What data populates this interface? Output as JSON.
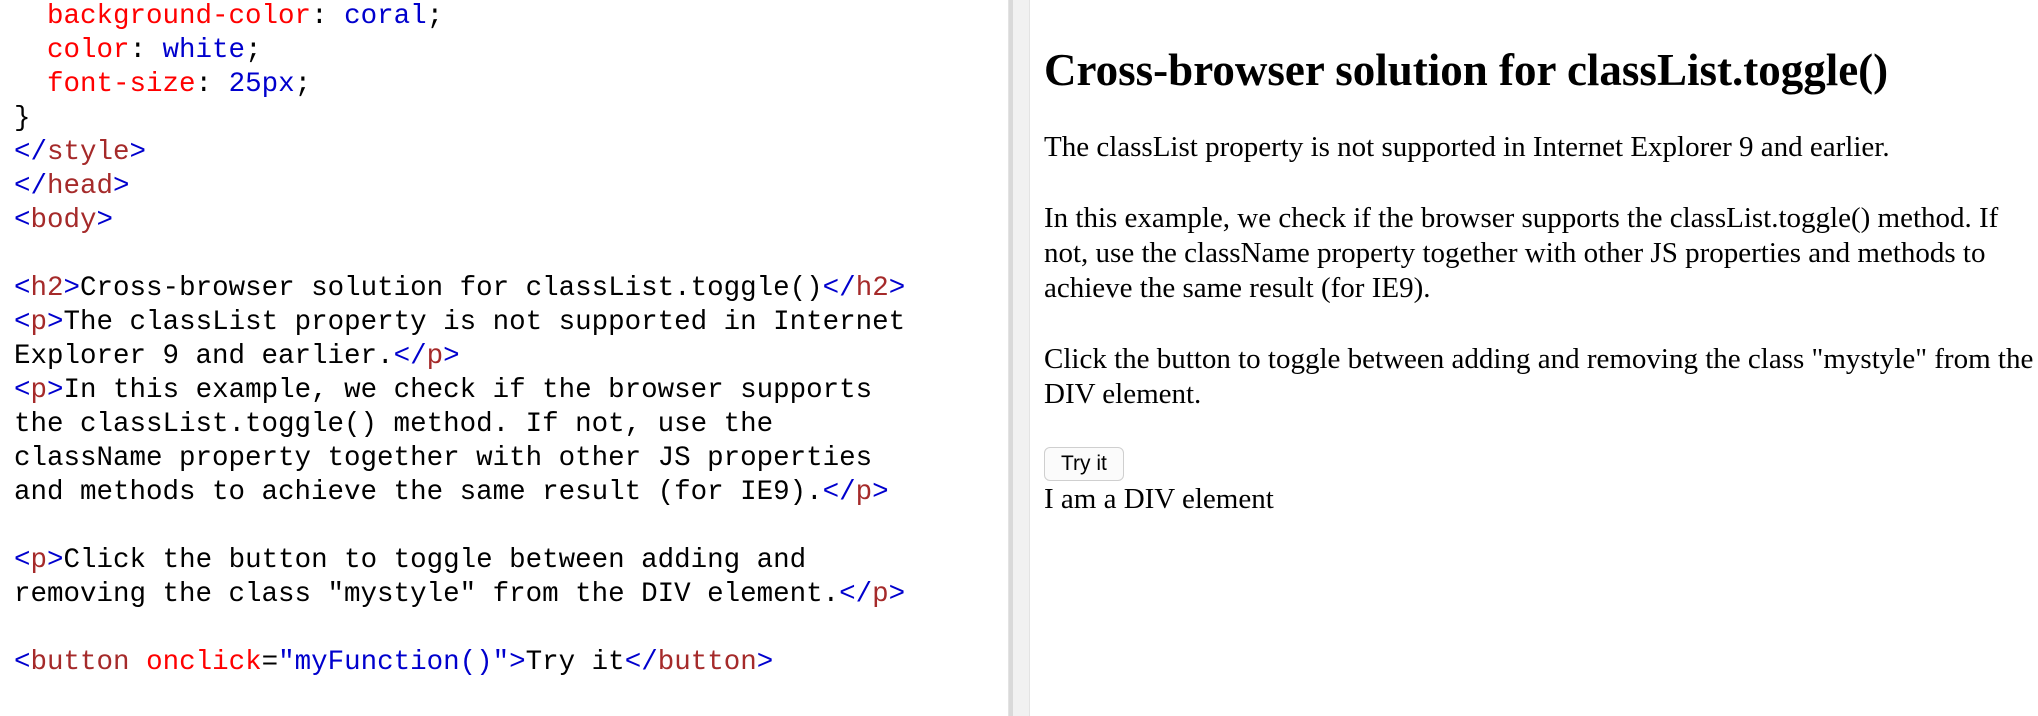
{
  "editor": {
    "lines": [
      [
        {
          "c": "tk-text",
          "t": "  "
        },
        {
          "c": "tk-prop",
          "t": "background-color"
        },
        {
          "c": "tk-text",
          "t": ": "
        },
        {
          "c": "tk-val",
          "t": "coral"
        },
        {
          "c": "tk-text",
          "t": ";"
        }
      ],
      [
        {
          "c": "tk-text",
          "t": "  "
        },
        {
          "c": "tk-prop",
          "t": "color"
        },
        {
          "c": "tk-text",
          "t": ": "
        },
        {
          "c": "tk-val",
          "t": "white"
        },
        {
          "c": "tk-text",
          "t": ";"
        }
      ],
      [
        {
          "c": "tk-text",
          "t": "  "
        },
        {
          "c": "tk-prop",
          "t": "font-size"
        },
        {
          "c": "tk-text",
          "t": ": "
        },
        {
          "c": "tk-val",
          "t": "25px"
        },
        {
          "c": "tk-text",
          "t": ";"
        }
      ],
      [
        {
          "c": "tk-text",
          "t": "}"
        }
      ],
      [
        {
          "c": "tk-tag",
          "t": "</"
        },
        {
          "c": "tk-name",
          "t": "style"
        },
        {
          "c": "tk-tag",
          "t": ">"
        }
      ],
      [
        {
          "c": "tk-tag",
          "t": "</"
        },
        {
          "c": "tk-name",
          "t": "head"
        },
        {
          "c": "tk-tag",
          "t": ">"
        }
      ],
      [
        {
          "c": "tk-tag",
          "t": "<"
        },
        {
          "c": "tk-name",
          "t": "body"
        },
        {
          "c": "tk-tag",
          "t": ">"
        }
      ],
      [],
      [
        {
          "c": "tk-tag",
          "t": "<"
        },
        {
          "c": "tk-name",
          "t": "h2"
        },
        {
          "c": "tk-tag",
          "t": ">"
        },
        {
          "c": "tk-text",
          "t": "Cross-browser solution for classList.toggle()"
        },
        {
          "c": "tk-tag",
          "t": "</"
        },
        {
          "c": "tk-name",
          "t": "h2"
        },
        {
          "c": "tk-tag",
          "t": ">"
        }
      ],
      [
        {
          "c": "tk-tag",
          "t": "<"
        },
        {
          "c": "tk-name",
          "t": "p"
        },
        {
          "c": "tk-tag",
          "t": ">"
        },
        {
          "c": "tk-text",
          "t": "The classList property is not supported in Internet"
        }
      ],
      [
        {
          "c": "tk-text",
          "t": "Explorer 9 and earlier."
        },
        {
          "c": "tk-tag",
          "t": "</"
        },
        {
          "c": "tk-name",
          "t": "p"
        },
        {
          "c": "tk-tag",
          "t": ">"
        }
      ],
      [
        {
          "c": "tk-tag",
          "t": "<"
        },
        {
          "c": "tk-name",
          "t": "p"
        },
        {
          "c": "tk-tag",
          "t": ">"
        },
        {
          "c": "tk-text",
          "t": "In this example, we check if the browser supports"
        }
      ],
      [
        {
          "c": "tk-text",
          "t": "the classList.toggle() method. If not, use the"
        }
      ],
      [
        {
          "c": "tk-text",
          "t": "className property together with other JS properties"
        }
      ],
      [
        {
          "c": "tk-text",
          "t": "and methods to achieve the same result (for IE9)."
        },
        {
          "c": "tk-tag",
          "t": "</"
        },
        {
          "c": "tk-name",
          "t": "p"
        },
        {
          "c": "tk-tag",
          "t": ">"
        }
      ],
      [],
      [
        {
          "c": "tk-tag",
          "t": "<"
        },
        {
          "c": "tk-name",
          "t": "p"
        },
        {
          "c": "tk-tag",
          "t": ">"
        },
        {
          "c": "tk-text",
          "t": "Click the button to toggle between adding and"
        }
      ],
      [
        {
          "c": "tk-text",
          "t": "removing the class \"mystyle\" from the DIV element."
        },
        {
          "c": "tk-tag",
          "t": "</"
        },
        {
          "c": "tk-name",
          "t": "p"
        },
        {
          "c": "tk-tag",
          "t": ">"
        }
      ],
      [],
      [
        {
          "c": "tk-tag",
          "t": "<"
        },
        {
          "c": "tk-name",
          "t": "button"
        },
        {
          "c": "tk-text",
          "t": " "
        },
        {
          "c": "tk-attr",
          "t": "onclick"
        },
        {
          "c": "tk-text",
          "t": "="
        },
        {
          "c": "tk-str",
          "t": "\"myFunction()\""
        },
        {
          "c": "tk-tag",
          "t": ">"
        },
        {
          "c": "tk-text",
          "t": "Try it"
        },
        {
          "c": "tk-tag",
          "t": "</"
        },
        {
          "c": "tk-name",
          "t": "button"
        },
        {
          "c": "tk-tag",
          "t": ">"
        }
      ]
    ]
  },
  "preview": {
    "heading": "Cross-browser solution for classList.toggle()",
    "para1": "The classList property is not supported in Internet Explorer 9 and earlier.",
    "para2": "In this example, we check if the browser supports the classList.toggle() method. If not, use the className property together with other JS properties and methods to achieve the same result (for IE9).",
    "para3": "Click the button to toggle between adding and removing the class \"mystyle\" from the DIV element.",
    "button_label": "Try it",
    "div_text": "I am a DIV element"
  },
  "colors": {
    "tag_bracket": "#0000cd",
    "tag_name": "#a52a2a",
    "attribute": "#ff0000",
    "css_property": "#ff0000",
    "value": "#0000cd",
    "divider": "#f1f1f1"
  }
}
